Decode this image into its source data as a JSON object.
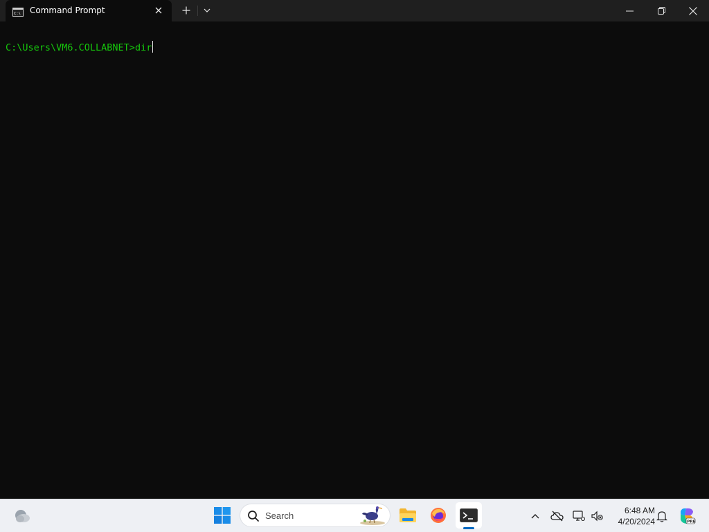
{
  "window": {
    "tab_title": "Command Prompt",
    "tab_icon": "cmd-icon",
    "controls": [
      "minimize-icon",
      "restore-icon",
      "close-icon"
    ]
  },
  "terminal": {
    "prompt": "C:\\Users\\VM6.COLLABNET>",
    "command": "dir",
    "text_color": "#16c60c",
    "background": "#0c0c0c"
  },
  "taskbar": {
    "search_placeholder": "Search",
    "time": "6:48 AM",
    "date": "4/20/2024",
    "apps": [
      "start-icon",
      "file-explorer-icon",
      "firefox-icon",
      "terminal-icon"
    ],
    "active_app": "terminal",
    "accent": "#0067c0"
  }
}
